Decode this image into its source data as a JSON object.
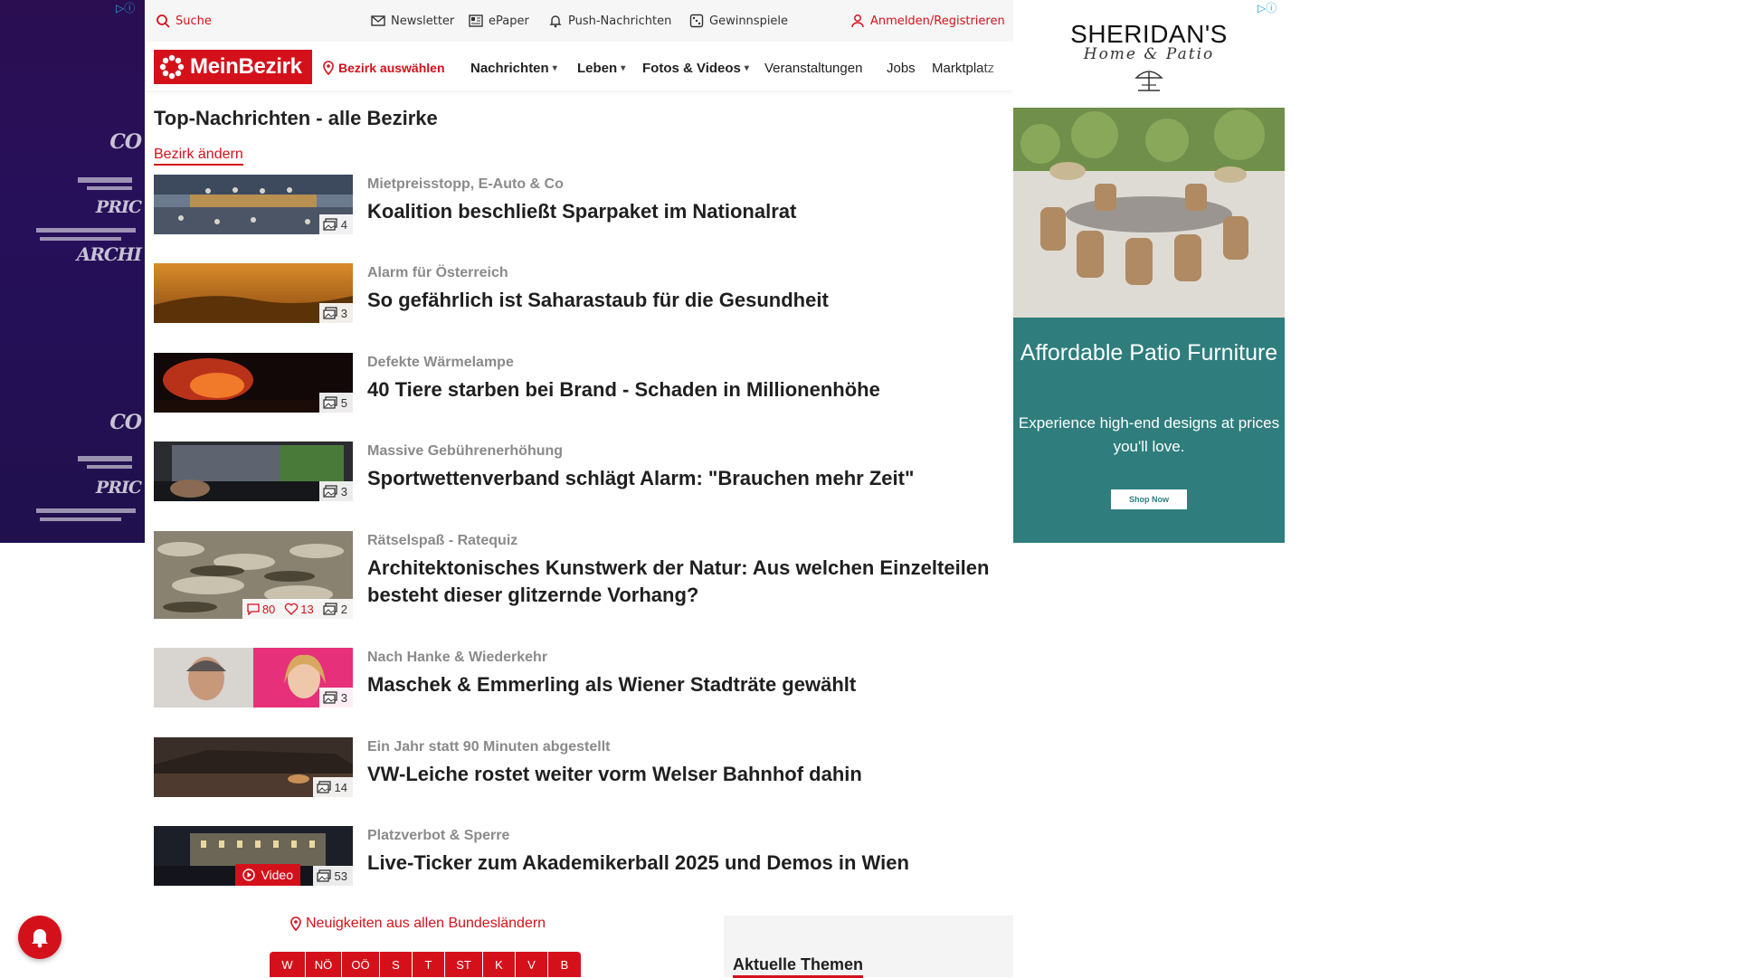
{
  "utility_bar": {
    "search_label": "Suche",
    "newsletter_label": "Newsletter",
    "epaper_label": "ePaper",
    "push_label": "Push-Nachrichten",
    "games_label": "Gewinnspiele",
    "login_label": "Anmelden/Registrieren"
  },
  "nav": {
    "logo_text": "MeinBezirk",
    "district_label": "Bezirk auswählen",
    "items": [
      {
        "label": "Nachrichten",
        "has_dropdown": true
      },
      {
        "label": "Leben",
        "has_dropdown": true
      },
      {
        "label": "Fotos & Videos",
        "has_dropdown": true
      },
      {
        "label": "Veranstaltungen",
        "has_dropdown": false
      },
      {
        "label": "Jobs",
        "has_dropdown": false
      },
      {
        "label": "Marktplatz",
        "has_dropdown": false
      }
    ]
  },
  "page": {
    "title": "Top-Nachrichten - alle Bezirke",
    "change_link": "Bezirk ändern"
  },
  "articles": [
    {
      "kicker": "Mietpreisstopp, E-Auto & Co",
      "headline": "Koalition beschließt Sparpaket im Nationalrat",
      "images": "4"
    },
    {
      "kicker": "Alarm für Österreich",
      "headline": "So gefährlich ist Saharastaub für die Gesundheit",
      "images": "3"
    },
    {
      "kicker": "Defekte Wärmelampe",
      "headline": "40 Tiere starben bei Brand - Schaden in Millionenhöhe",
      "images": "5"
    },
    {
      "kicker": "Massive Gebührenerhöhung",
      "headline": "Sportwettenverband schlägt Alarm: \"Brauchen mehr Zeit\"",
      "images": "3"
    },
    {
      "kicker": "Rätselspaß - Ratequiz",
      "headline": "Architektonisches Kunstwerk der Natur: Aus welchen Einzelteilen besteht dieser glitzernde Vorhang?",
      "images": "2",
      "comments": "80",
      "likes": "13"
    },
    {
      "kicker": "Nach Hanke & Wiederkehr",
      "headline": "Maschek & Emmerling als Wiener Stadträte gewählt",
      "images": "3"
    },
    {
      "kicker": "Ein Jahr statt 90 Minuten abgestellt",
      "headline": "VW-Leiche rostet weiter vorm Welser Bahnhof dahin",
      "images": "14"
    },
    {
      "kicker": "Platzverbot & Sperre",
      "headline": "Live-Ticker zum Akademikerball 2025 und Demos in Wien",
      "images": "53",
      "video_label": "Video"
    }
  ],
  "states": {
    "heading": "Neuigkeiten aus allen Bundesländern",
    "buttons": [
      "W",
      "NÖ",
      "OÖ",
      "S",
      "T",
      "ST",
      "K",
      "V",
      "B"
    ]
  },
  "topics": {
    "heading": "Aktuelle Themen"
  },
  "right_ad": {
    "brand": "SHERIDAN'S",
    "subbrand": "Home & Patio",
    "headline": "Affordable Patio Furniture",
    "body": "Experience high-end designs at prices you'll love.",
    "cta": "Shop Now"
  },
  "left_ad": {
    "fragments": [
      "CO",
      "PRIC",
      "ARCHI",
      "CO",
      "PRIC"
    ]
  },
  "colors": {
    "brand_red": "#d4111b",
    "ad_teal": "#2f7d7d",
    "ad_purple": "#2b0e52"
  }
}
